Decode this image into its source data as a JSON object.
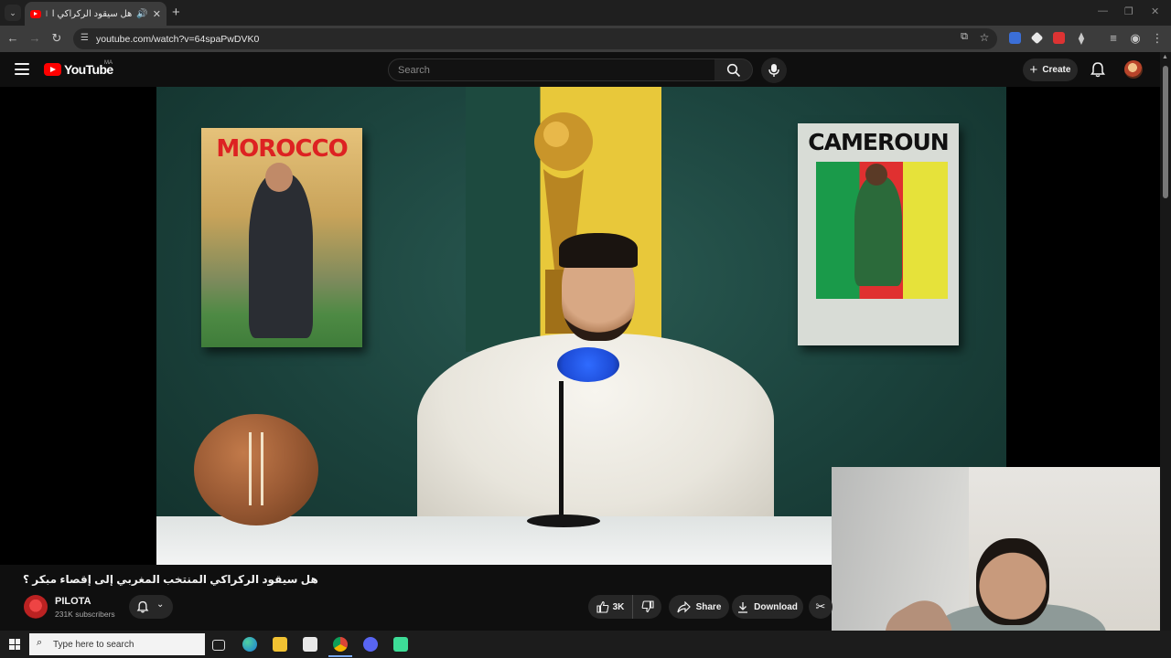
{
  "browser": {
    "tab_title": "هل سيقود الركراكي المنتخب",
    "tab_prefix": "l",
    "new_tab_symbol": "+",
    "url": "youtube.com/watch?v=64spaPwDVK0",
    "icons": [
      "back-icon",
      "forward-icon",
      "reload-icon",
      "site-info-icon",
      "install-icon",
      "bookmark-star-icon",
      "extensions-icon",
      "profile-icon",
      "more-icon"
    ]
  },
  "youtube": {
    "logo_text": "YouTube",
    "country_code": "MA",
    "search_placeholder": "Search",
    "create_label": "Create",
    "brand_color": "#ff0000"
  },
  "video": {
    "title": "هل سيقود الركراكي المنتخب المغربي إلى إقصاء مبكر ؟",
    "poster_left_text": "MOROCCO",
    "poster_right_text": "CAMEROUN",
    "channel": {
      "name": "PILOTA",
      "subscribers": "231K subscribers"
    },
    "actions": {
      "likes": "3K",
      "share_label": "Share",
      "download_label": "Download"
    }
  },
  "taskbar": {
    "search_placeholder": "Type here to search",
    "apps": [
      "task-view-icon",
      "edge-icon",
      "file-explorer-icon",
      "store-icon",
      "chrome-icon",
      "discord-icon",
      "app-icon"
    ]
  }
}
